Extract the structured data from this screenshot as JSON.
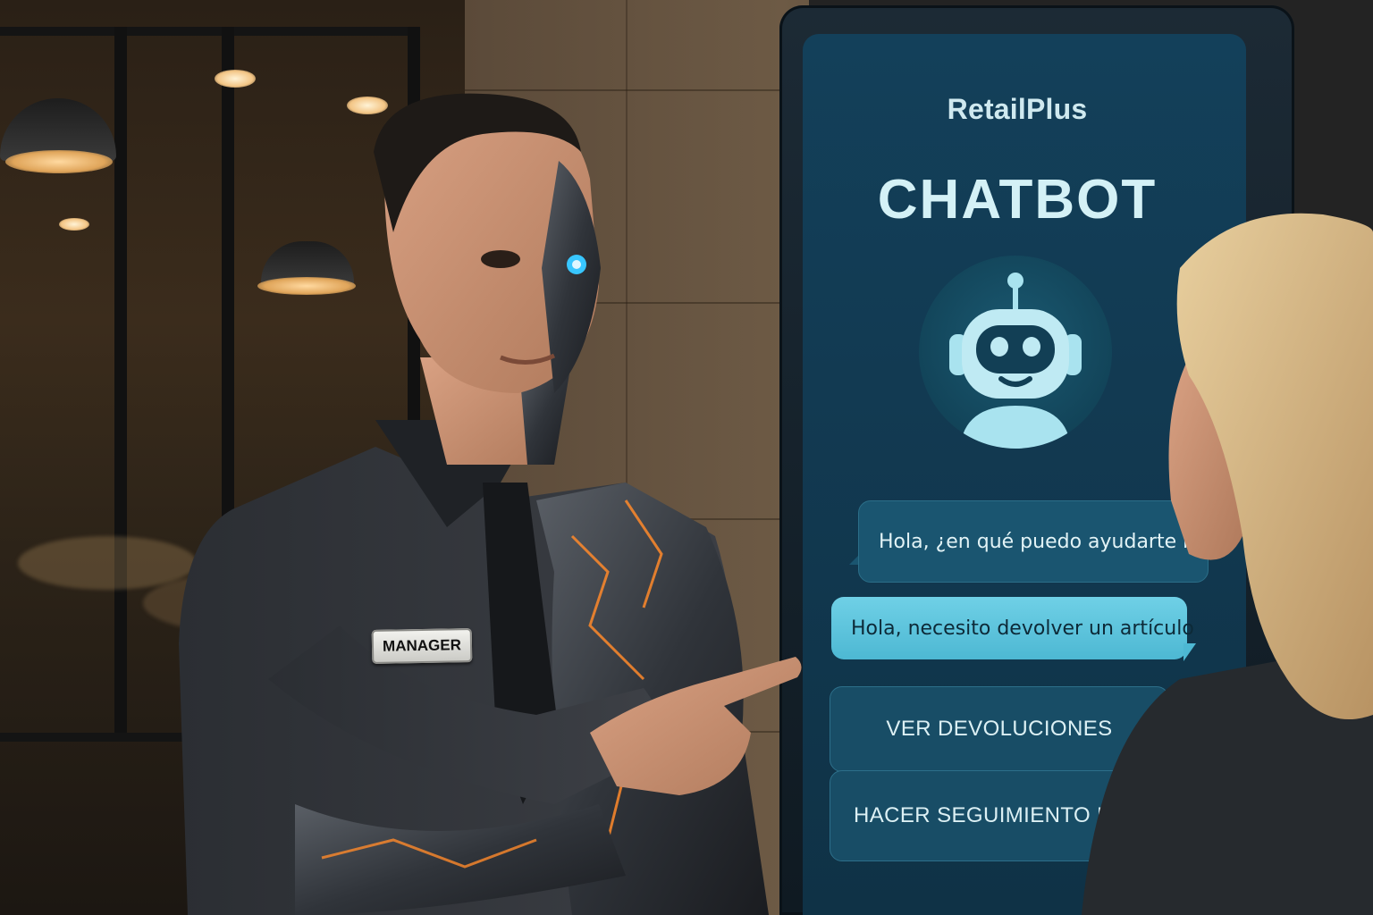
{
  "kiosk": {
    "brand": "RetailPlus",
    "title": "CHATBOT",
    "avatar_icon": "robot-icon",
    "bot_message": "Hola, ¿en qué puedo ayudarte hoy?",
    "user_message": "Hola, necesito devolver un artículo",
    "options": [
      {
        "label": "VER DEVOLUCIONES"
      },
      {
        "label": "HACER SEGUIMIENTO DE PEDIDO"
      }
    ]
  },
  "person": {
    "badge": "MANAGER"
  },
  "colors": {
    "screen": "#13405a",
    "bubble_user": "#5cc4dc",
    "bubble_bot": "#1a5570",
    "cyber_glow": "#ff8a2a",
    "eye_glow": "#38c6ff"
  }
}
